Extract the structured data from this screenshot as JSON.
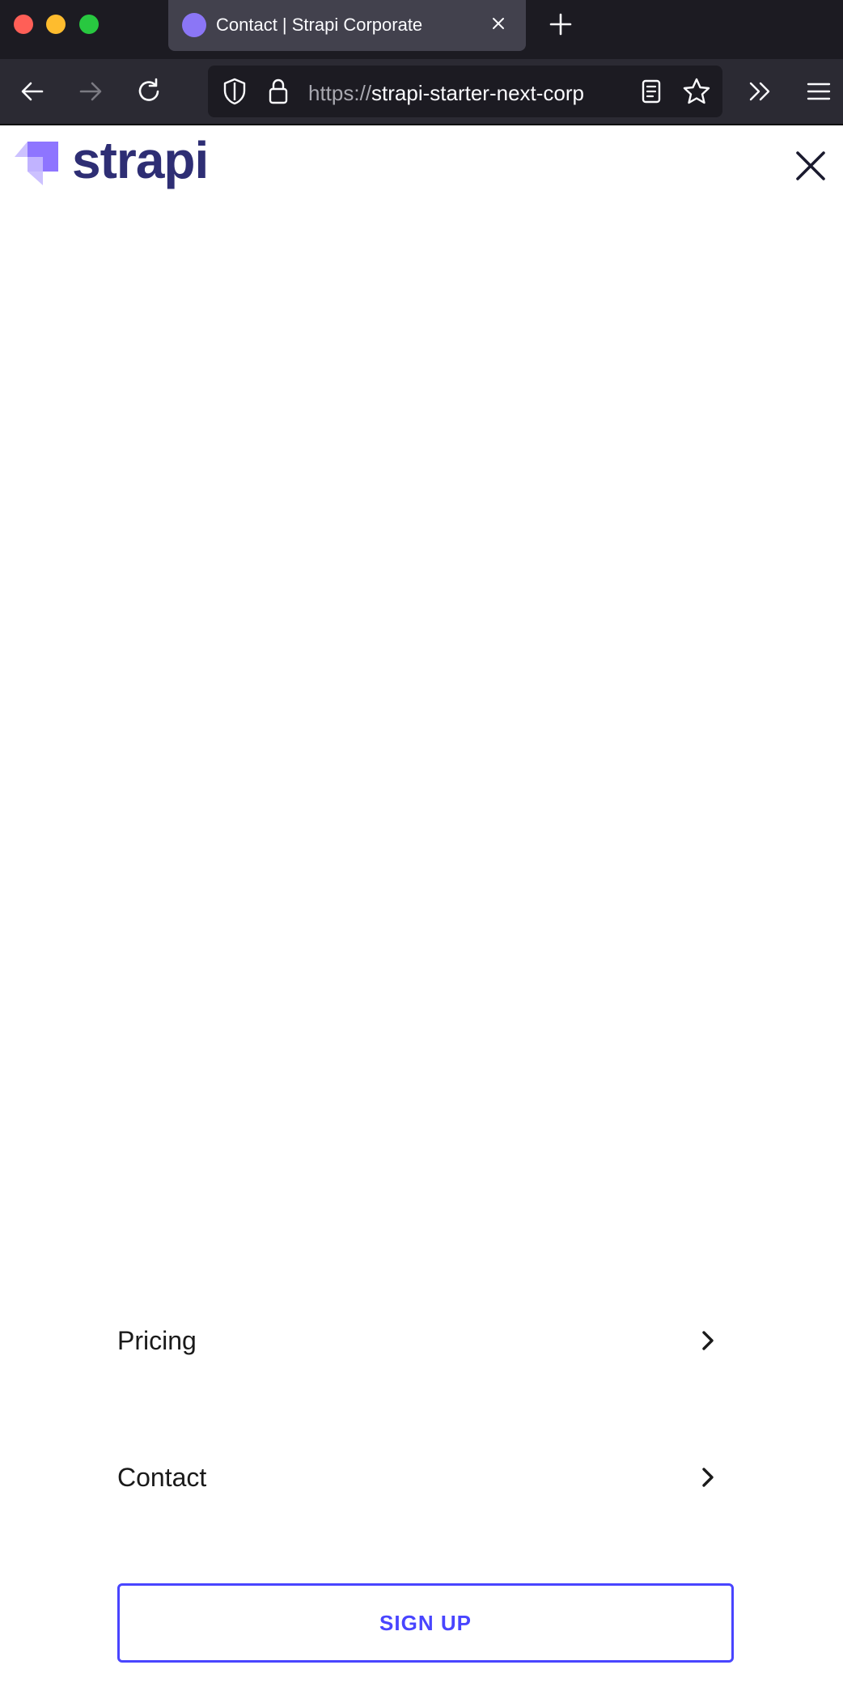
{
  "browser": {
    "tab_title": "Contact | Strapi Corporate",
    "url_scheme": "https://",
    "url_host": "strapi-starter-next-corp"
  },
  "icons": {
    "back": "arrow-left-icon",
    "forward": "arrow-right-icon",
    "reload": "reload-icon",
    "shield": "shield-icon",
    "lock": "lock-icon",
    "reader": "reader-view-icon",
    "bookmark": "star-icon",
    "overflow": "chevrons-right-icon",
    "app_menu": "hamburger-icon"
  },
  "site": {
    "logo_text": "strapi",
    "brand_color": "#4945ff",
    "logo_text_color": "#2e2e74"
  },
  "mobile_menu": {
    "items": [
      {
        "label": "Pricing"
      },
      {
        "label": "Contact"
      }
    ],
    "signup_label": "SIGN UP"
  }
}
